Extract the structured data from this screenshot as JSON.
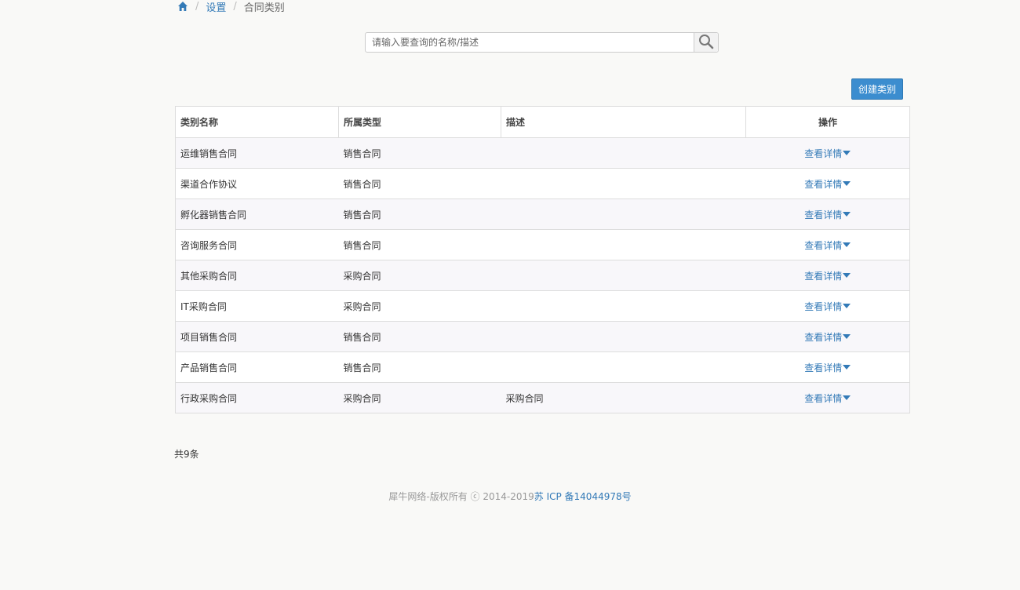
{
  "breadcrumb": {
    "home_icon": "home-icon",
    "items": [
      "设置",
      "合同类别"
    ],
    "separator": "/"
  },
  "search": {
    "placeholder": "请输入要查询的名称/描述",
    "value": "",
    "button_icon": "search-icon"
  },
  "toolbar": {
    "create_label": "创建类别"
  },
  "table": {
    "columns": [
      "类别名称",
      "所属类型",
      "描述",
      "操作"
    ],
    "rows": [
      {
        "name": "运维销售合同",
        "type": "销售合同",
        "desc": "",
        "action": "查看详情"
      },
      {
        "name": "渠道合作协议",
        "type": "销售合同",
        "desc": "",
        "action": "查看详情"
      },
      {
        "name": "孵化器销售合同",
        "type": "销售合同",
        "desc": "",
        "action": "查看详情"
      },
      {
        "name": "咨询服务合同",
        "type": "销售合同",
        "desc": "",
        "action": "查看详情"
      },
      {
        "name": "其他采购合同",
        "type": "采购合同",
        "desc": "",
        "action": "查看详情"
      },
      {
        "name": "IT采购合同",
        "type": "采购合同",
        "desc": "",
        "action": "查看详情"
      },
      {
        "name": "项目销售合同",
        "type": "销售合同",
        "desc": "",
        "action": "查看详情"
      },
      {
        "name": "产品销售合同",
        "type": "销售合同",
        "desc": "",
        "action": "查看详情"
      },
      {
        "name": "行政采购合同",
        "type": "采购合同",
        "desc": "采购合同",
        "action": "查看详情"
      }
    ]
  },
  "total": "共9条",
  "footer": {
    "copyright": "犀牛网络-版权所有 ⓒ 2014-2019",
    "icp": "苏 ICP 备14044978号"
  },
  "colors": {
    "accent": "#337ab7",
    "button": "#3c8dcf",
    "background": "#f9f9f7",
    "row_alt": "#f8f7fa"
  }
}
